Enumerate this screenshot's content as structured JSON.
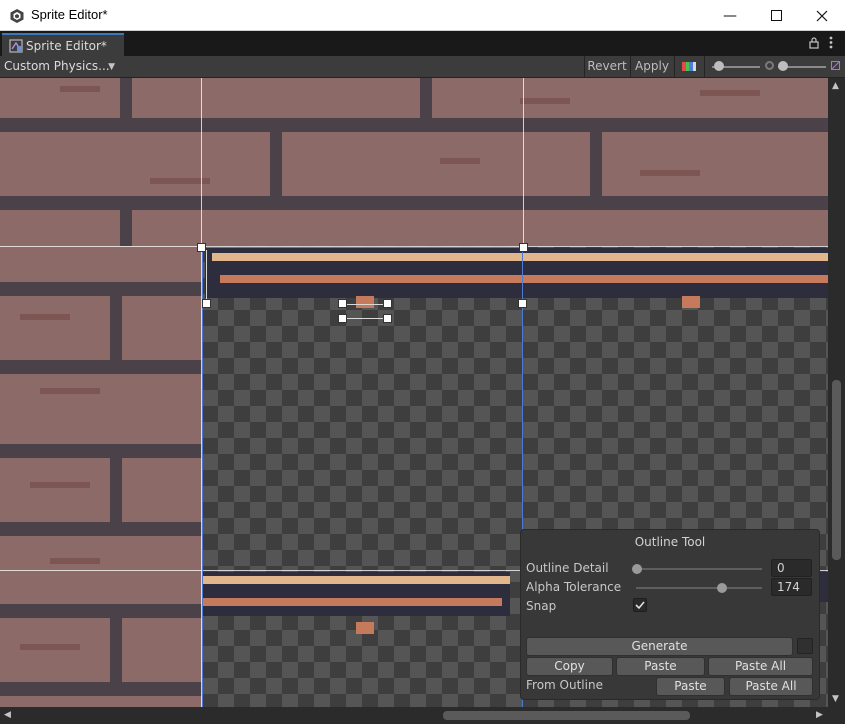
{
  "window": {
    "title": "Sprite Editor*",
    "minimize_icon": "minimize-icon",
    "maximize_icon": "maximize-icon",
    "close_icon": "close-icon"
  },
  "tab": {
    "label": "Sprite Editor*",
    "icon": "sprite-editor-icon",
    "lock_icon": "lock-icon",
    "menu_icon": "more-vertical-icon"
  },
  "toolbar": {
    "mode_dropdown": "Custom Physics...",
    "revert_label": "Revert",
    "apply_label": "Apply",
    "color_channel_icon": "rgb-channels-icon",
    "alpha_zoom_icon": "alpha-icon",
    "mip_icon": "mip-level-icon"
  },
  "outline_tool": {
    "title": "Outline Tool",
    "outline_detail_label": "Outline Detail",
    "outline_detail_value": "0",
    "outline_detail_fraction": 0.0,
    "alpha_tolerance_label": "Alpha Tolerance",
    "alpha_tolerance_value": "174",
    "alpha_tolerance_fraction": 0.68,
    "snap_label": "Snap",
    "snap_checked": true,
    "generate_label": "Generate",
    "copy_label": "Copy",
    "paste_label": "Paste",
    "paste_all_label": "Paste All",
    "from_outline_label": "From Outline",
    "from_outline_paste_label": "Paste",
    "from_outline_paste_all_label": "Paste All"
  },
  "colors": {
    "accent": "#3a79bb",
    "selection": "#4d7bd4",
    "brick": "#8c6a67",
    "wood_light": "#e2b68c",
    "wood_mid": "#c57a5c",
    "wood_dark": "#2d2d3e"
  }
}
